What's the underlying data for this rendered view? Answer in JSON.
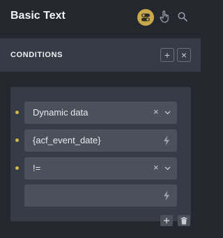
{
  "header": {
    "title": "Basic Text",
    "icons": [
      "toggle-icon",
      "pointer-icon",
      "search-icon"
    ],
    "accent_color": "#c9a84c"
  },
  "conditions": {
    "title": "CONDITIONS",
    "add_label": "+",
    "close_label": "×"
  },
  "group": {
    "rows": [
      {
        "value": "Dynamic data",
        "type": "select"
      },
      {
        "value": "{acf_event_date}",
        "type": "dynamic"
      },
      {
        "value": "!=",
        "type": "select"
      },
      {
        "value": "",
        "type": "dynamic"
      }
    ],
    "clear_label": "×"
  }
}
